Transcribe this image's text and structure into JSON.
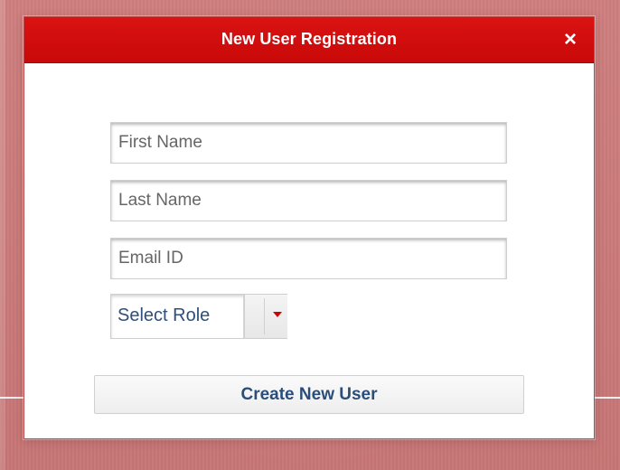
{
  "modal": {
    "title": "New User Registration",
    "close_label": "×"
  },
  "form": {
    "first_name": {
      "placeholder": "First Name",
      "value": ""
    },
    "last_name": {
      "placeholder": "Last Name",
      "value": ""
    },
    "email": {
      "placeholder": "Email ID",
      "value": ""
    },
    "role": {
      "selected_label": "Select Role"
    },
    "submit_label": "Create New User"
  },
  "icons": {
    "close": "close-icon",
    "dropdown": "caret-down-icon"
  },
  "colors": {
    "header": "#cc0a0a",
    "accent_text": "#2b4d79",
    "dropdown_arrow": "#d20000"
  }
}
